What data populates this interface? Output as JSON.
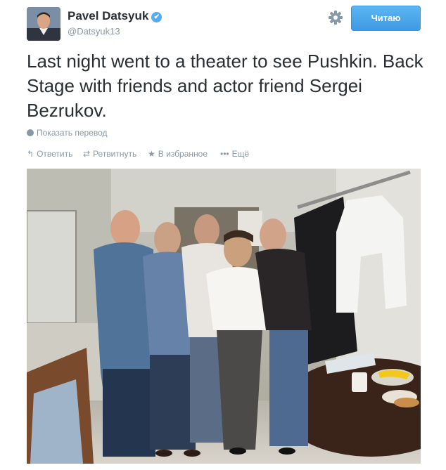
{
  "header": {
    "name": "Pavel Datsyuk",
    "handle": "@Datsyuk13",
    "follow_label": "Читаю"
  },
  "tweet": {
    "text": "Last night went to a theater to see Pushkin. Back Stage with friends and actor friend Sergei Bezrukov.",
    "translate_label": "Показать перевод"
  },
  "actions": {
    "reply": "Ответить",
    "retweet": "Ретвитнуть",
    "favorite": "В избранное",
    "more": "Ещё"
  },
  "icons": {
    "verified": "verified-badge-icon",
    "settings": "gear-icon",
    "translate": "globe-icon",
    "reply": "reply-icon",
    "retweet": "retweet-icon",
    "favorite": "star-icon",
    "more": "ellipsis-icon"
  },
  "colors": {
    "accent": "#55acee",
    "muted": "#8899a6",
    "text": "#292f33"
  }
}
